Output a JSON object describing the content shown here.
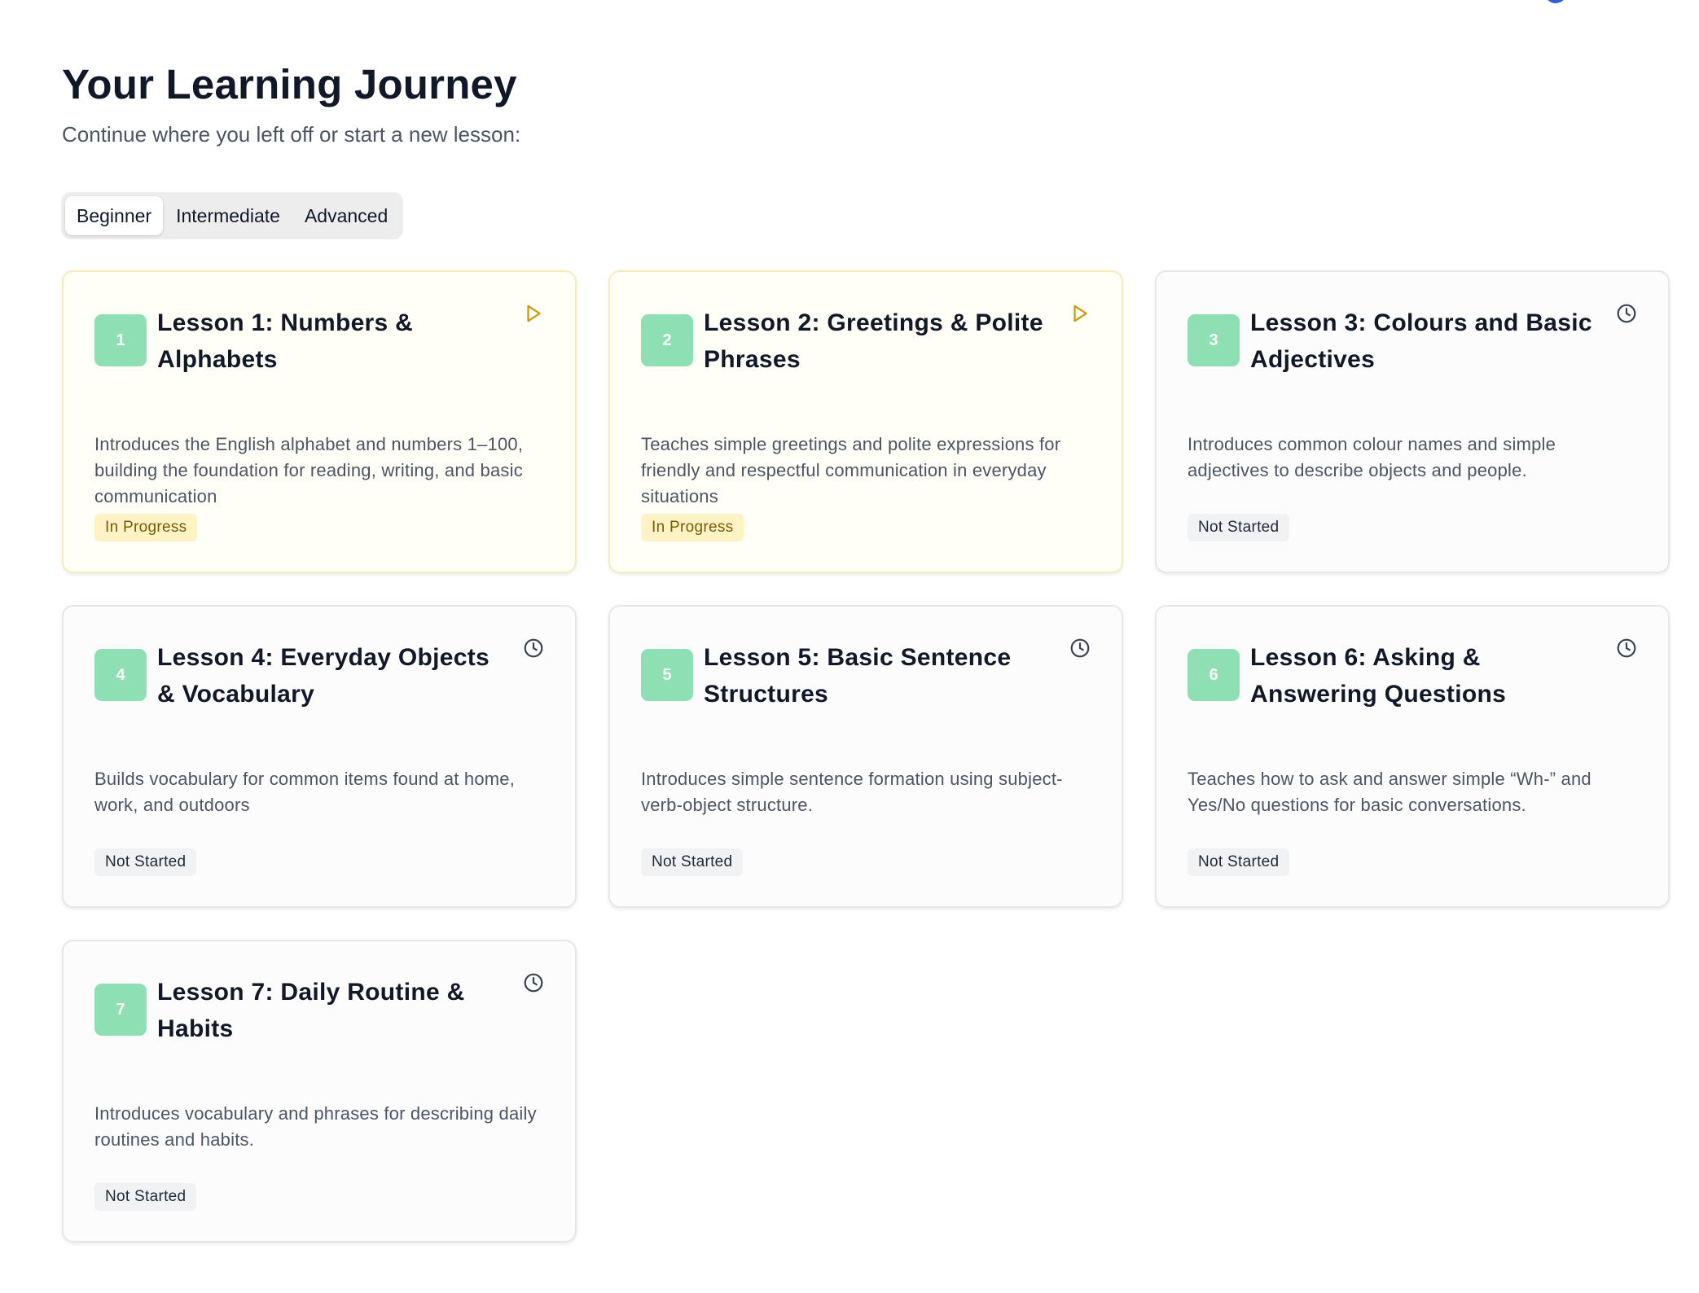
{
  "header": {
    "title": "Your Learning Journey",
    "subtitle": "Continue where you left off or start a new lesson:"
  },
  "tabs": [
    {
      "label": "Beginner",
      "active": true
    },
    {
      "label": "Intermediate",
      "active": false
    },
    {
      "label": "Advanced",
      "active": false
    }
  ],
  "lessons": [
    {
      "number": "1",
      "title": "Lesson 1: Numbers & Alphabets",
      "description": "Introduces the English alphabet and numbers 1–100, building the foundation for reading, writing, and basic communication",
      "status": "In Progress",
      "icon": "play-icon"
    },
    {
      "number": "2",
      "title": "Lesson 2: Greetings & Polite Phrases",
      "description": "Teaches simple greetings and polite expressions for friendly and respectful communication in everyday situations",
      "status": "In Progress",
      "icon": "play-icon"
    },
    {
      "number": "3",
      "title": "Lesson 3: Colours and Basic Adjectives",
      "description": "Introduces common colour names and simple adjectives to describe objects and people.",
      "status": "Not Started",
      "icon": "clock-icon"
    },
    {
      "number": "4",
      "title": "Lesson 4: Everyday Objects & Vocabulary",
      "description": "Builds vocabulary for common items found at home, work, and outdoors",
      "status": "Not Started",
      "icon": "clock-icon"
    },
    {
      "number": "5",
      "title": "Lesson 5: Basic Sentence Structures",
      "description": "Introduces simple sentence formation using subject-verb-object structure.",
      "status": "Not Started",
      "icon": "clock-icon"
    },
    {
      "number": "6",
      "title": "Lesson 6: Asking & Answering Questions",
      "description": "Teaches how to ask and answer simple “Wh-” and Yes/No questions for basic conversations.",
      "status": "Not Started",
      "icon": "clock-icon"
    },
    {
      "number": "7",
      "title": "Lesson 7: Daily Routine & Habits",
      "description": "Introduces vocabulary and phrases for describing daily routines and habits.",
      "status": "Not Started",
      "icon": "clock-icon"
    }
  ],
  "colors": {
    "accent_green": "#8ee0b4",
    "in_progress_bg": "#fdf3c4",
    "in_progress_text": "#7a5a05",
    "play_icon": "#c9960c"
  }
}
